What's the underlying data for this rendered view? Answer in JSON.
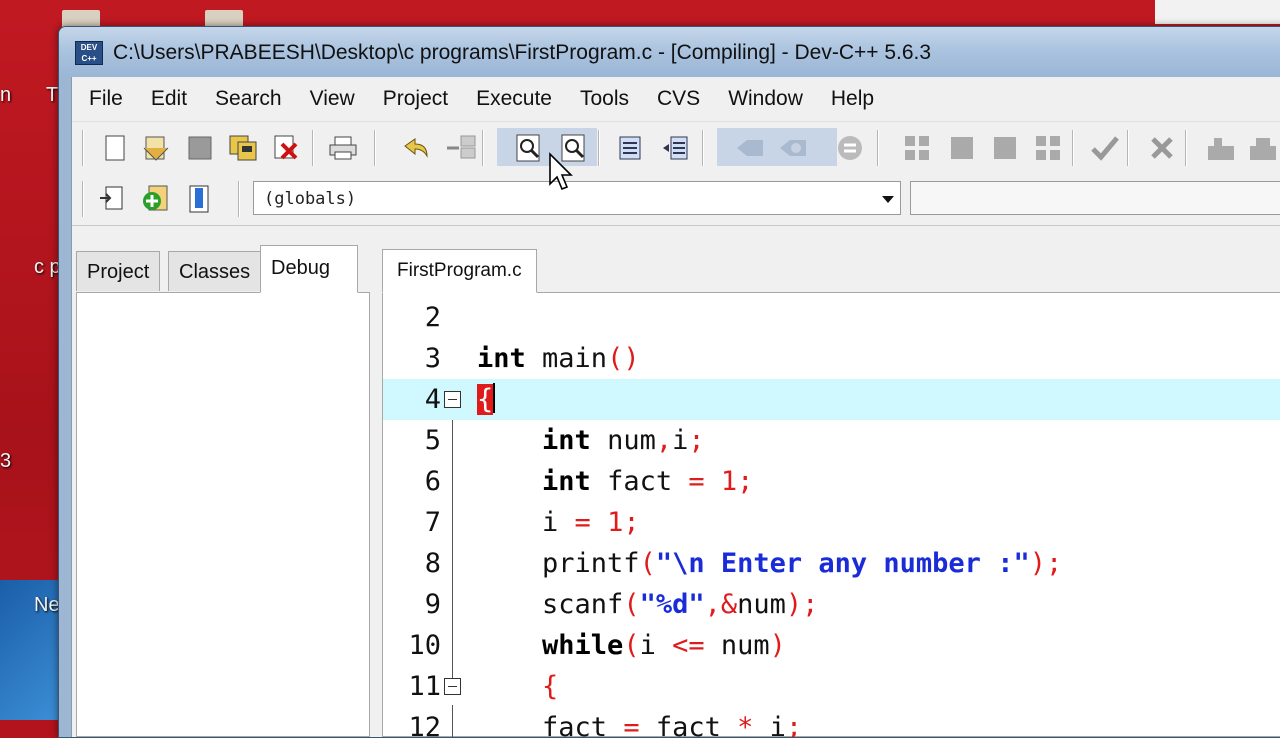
{
  "window": {
    "title": "C:\\Users\\PRABEESH\\Desktop\\c programs\\FirstProgram.c - [Compiling] - Dev-C++ 5.6.3",
    "app_icon_text": "DEV C++"
  },
  "desktop": {
    "fragments": [
      "n",
      "T",
      "c p",
      "3",
      "Ne"
    ]
  },
  "menu": {
    "items": [
      "File",
      "Edit",
      "Search",
      "View",
      "Project",
      "Execute",
      "Tools",
      "CVS",
      "Window",
      "Help"
    ]
  },
  "toolbar2": {
    "scope_combo_value": "(globals)"
  },
  "left_panel": {
    "tabs": [
      "Project",
      "Classes",
      "Debug"
    ],
    "active_tab": "Debug"
  },
  "editor": {
    "file_tab": "FirstProgram.c",
    "current_line": 4,
    "lines": [
      {
        "n": "2",
        "text": ""
      },
      {
        "n": "3",
        "text": "int main()"
      },
      {
        "n": "4",
        "text": "{"
      },
      {
        "n": "5",
        "text": "    int num,i;"
      },
      {
        "n": "6",
        "text": "    int fact = 1;"
      },
      {
        "n": "7",
        "text": "    i = 1;"
      },
      {
        "n": "8",
        "text": "    printf(\"\\n Enter any number :\");"
      },
      {
        "n": "9",
        "text": "    scanf(\"%d\",&num);"
      },
      {
        "n": "10",
        "text": "    while(i <= num)"
      },
      {
        "n": "11",
        "text": "    {"
      },
      {
        "n": "12",
        "text": "    fact = fact * i;"
      }
    ]
  },
  "colors": {
    "keyword": "#000000",
    "symbol": "#e01b1b",
    "string": "#1a2bd8",
    "current_line_bg": "#cff8ff",
    "desktop_bg": "#b3131c"
  }
}
